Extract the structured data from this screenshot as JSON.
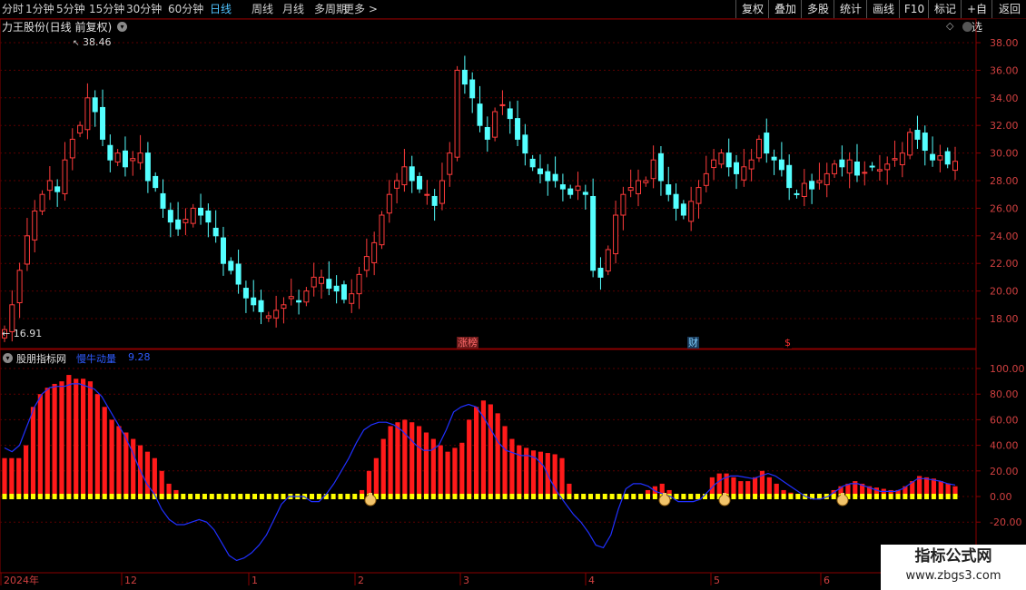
{
  "toolbar": {
    "periods": [
      "分时",
      "1分钟",
      "5分钟",
      "15分钟",
      "30分钟",
      "60分钟",
      "日线",
      "周线",
      "月线",
      "多周期",
      "更多 >"
    ],
    "active_period": "日线",
    "right_buttons": [
      "复权",
      "叠加",
      "多股",
      "统计",
      "画线",
      "F10",
      "标记",
      "+自选",
      "返回"
    ]
  },
  "main_chart": {
    "title": "力王股份(日线 前复权)",
    "high_label": "38.46",
    "low_label": "16.91",
    "price_axis": [
      "38.00",
      "36.00",
      "34.00",
      "32.00",
      "30.00",
      "28.00",
      "26.00",
      "24.00",
      "22.00",
      "20.00",
      "18.00"
    ],
    "markers": [
      {
        "text": "涨榜",
        "color": "#ff6a6a",
        "bg": "#6a1a1a"
      },
      {
        "text": "财",
        "color": "#7fd0ff",
        "bg": "#1a3a5a"
      },
      {
        "text": "$",
        "color": "#ff3030",
        "bg": "#000000"
      }
    ]
  },
  "indicator": {
    "source": "股朋指标网",
    "name": "慢牛动量",
    "value": "9.28",
    "axis": [
      "100.00",
      "80.00",
      "60.00",
      "40.00",
      "20.00",
      "0.00",
      "-20.00"
    ]
  },
  "date_axis": [
    "2024年",
    "12",
    "1",
    "2",
    "3",
    "4",
    "5",
    "6"
  ],
  "watermark": {
    "line1": "指标公式网",
    "line2": "www.zbgs3.com"
  },
  "colors": {
    "up": "#ff3b3b",
    "down": "#54ffff",
    "grid": "#5a0000",
    "axis_text": "#d04040",
    "curve": "#2030ff",
    "base": "#ffff00"
  },
  "chart_data": {
    "type": "candlestick",
    "x_axis": [
      "2024-11",
      "12",
      "1",
      "2",
      "3",
      "4",
      "5",
      "6"
    ],
    "y_range": [
      17,
      39
    ],
    "candles_summary_note": "",
    "closes": [
      17.2,
      19.0,
      21.5,
      24.0,
      25.8,
      27.0,
      28.0,
      27.2,
      29.5,
      31.0,
      32.0,
      34.0,
      33.0,
      31.0,
      29.5,
      30.0,
      29.0,
      29.6,
      30.0,
      28.0,
      27.5,
      26.0,
      25.0,
      24.5,
      25.2,
      26.0,
      25.5,
      25.0,
      24.0,
      22.0,
      21.5,
      20.5,
      19.5,
      19.0,
      18.5,
      18.2,
      18.6,
      19.0,
      19.6,
      19.2,
      20.0,
      21.0,
      21.0,
      20.2,
      20.0,
      19.4,
      19.8,
      21.2,
      22.5,
      23.5,
      25.5,
      27.0,
      28.0,
      29.0,
      28.0,
      27.4,
      27.0,
      26.2,
      28.0,
      30.0,
      36.0,
      35.0,
      34.0,
      32.0,
      31.0,
      33.0,
      33.5,
      32.5,
      31.0,
      30.0,
      29.0,
      28.5,
      28.0,
      28.0,
      27.4,
      27.0,
      27.6,
      27.0,
      21.5,
      21.0,
      23.0,
      25.5,
      27.0,
      27.5,
      28.0,
      28.0,
      29.5,
      28.0,
      27.0,
      26.0,
      25.5,
      26.5,
      27.5,
      28.5,
      29.5,
      30.0,
      29.0,
      28.5,
      29.0,
      29.5,
      31.0,
      30.0,
      29.5,
      28.8,
      27.5,
      27.0,
      27.8,
      27.4,
      28.0,
      28.5,
      29.2,
      29.0,
      29.5,
      28.4,
      28.6,
      29.0,
      28.8,
      29.2,
      29.6,
      30.0,
      31.5,
      31.0,
      30.2,
      29.5,
      29.8,
      29.2,
      29.4
    ],
    "momentum_bars": [
      30,
      30,
      30,
      40,
      70,
      80,
      85,
      88,
      90,
      95,
      92,
      92,
      90,
      80,
      70,
      60,
      55,
      50,
      45,
      40,
      35,
      30,
      20,
      10,
      5,
      0,
      0,
      0,
      0,
      0,
      0,
      0,
      0,
      0,
      0,
      0,
      0,
      0,
      0,
      0,
      0,
      0,
      0,
      0,
      0,
      0,
      0,
      0,
      0,
      0,
      5,
      20,
      30,
      45,
      55,
      58,
      60,
      58,
      55,
      50,
      45,
      40,
      35,
      38,
      42,
      60,
      70,
      75,
      72,
      65,
      55,
      45,
      40,
      38,
      36,
      35,
      34,
      33,
      30,
      10,
      0,
      0,
      0,
      0,
      0,
      0,
      0,
      0,
      0,
      0,
      5,
      8,
      10,
      5,
      2,
      0,
      0,
      0,
      0,
      15,
      18,
      18,
      15,
      12,
      12,
      15,
      20,
      15,
      10,
      5,
      3,
      2,
      0,
      0,
      0,
      0,
      5,
      8,
      10,
      12,
      10,
      8,
      7,
      6,
      5,
      5,
      8,
      12,
      16,
      15,
      14,
      12,
      10,
      8
    ],
    "momentum_curve": [
      38,
      35,
      40,
      55,
      70,
      80,
      85,
      86,
      86,
      88,
      88,
      86,
      84,
      78,
      68,
      58,
      48,
      36,
      22,
      10,
      2,
      -10,
      -18,
      -22,
      -22,
      -20,
      -18,
      -20,
      -26,
      -36,
      -46,
      -50,
      -48,
      -44,
      -38,
      -30,
      -18,
      -6,
      0,
      0,
      0,
      -4,
      -4,
      2,
      10,
      20,
      30,
      42,
      52,
      56,
      58,
      58,
      56,
      52,
      46,
      40,
      36,
      36,
      40,
      52,
      66,
      70,
      72,
      70,
      62,
      52,
      42,
      36,
      34,
      32,
      32,
      30,
      24,
      12,
      2,
      -6,
      -14,
      -20,
      -28,
      -38,
      -40,
      -30,
      -10,
      6,
      10,
      10,
      8,
      4,
      2,
      0,
      -4,
      -4,
      -4,
      -2,
      4,
      10,
      14,
      16,
      16,
      15,
      14,
      16,
      18,
      16,
      12,
      8,
      4,
      0,
      -2,
      -2,
      0,
      4,
      8,
      10,
      10,
      8,
      6,
      4,
      4,
      4,
      6,
      10,
      14,
      14,
      13,
      12,
      10,
      9
    ]
  }
}
